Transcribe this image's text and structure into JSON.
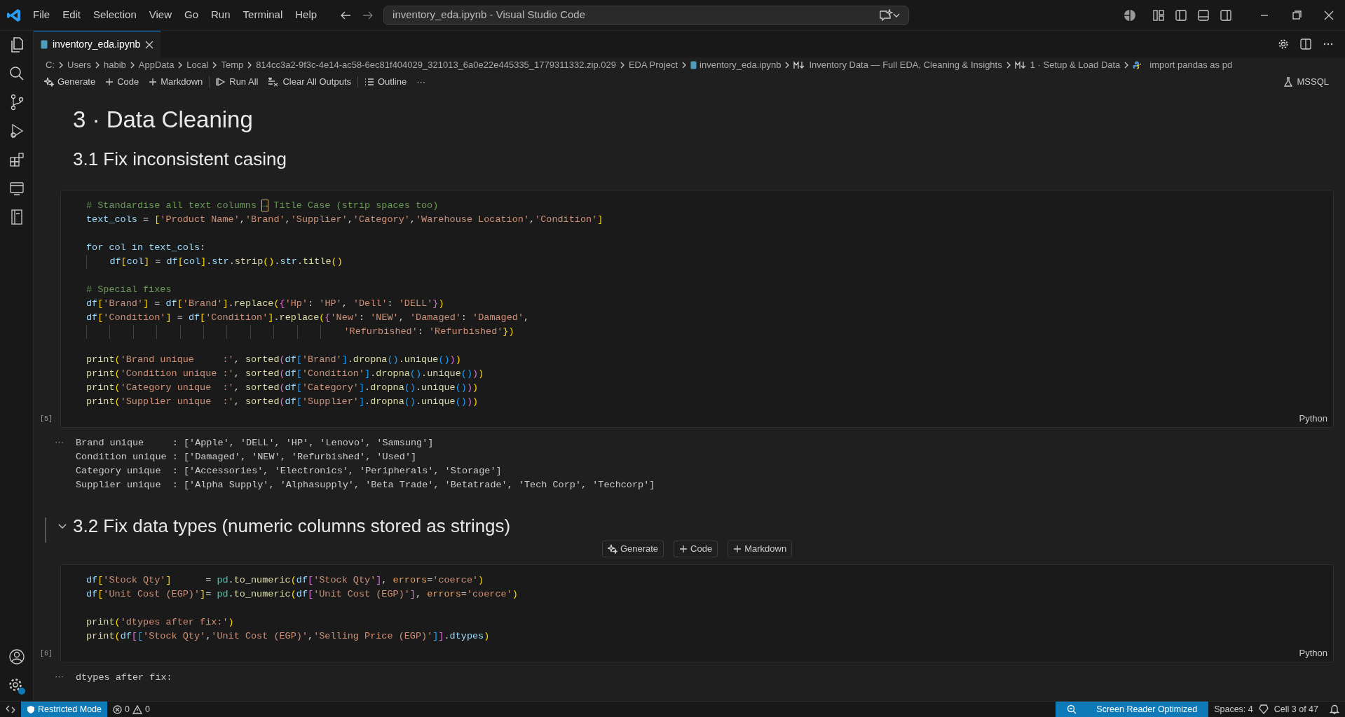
{
  "title_bar": {
    "menu": [
      "File",
      "Edit",
      "Selection",
      "View",
      "Go",
      "Run",
      "Terminal",
      "Help"
    ],
    "search": "inventory_eda.ipynb - Visual Studio Code"
  },
  "tabs": [
    {
      "label": "inventory_eda.ipynb",
      "selected": true
    }
  ],
  "breadcrumb": [
    {
      "kind": "text",
      "label": "C:"
    },
    {
      "kind": "text",
      "label": "Users"
    },
    {
      "kind": "text",
      "label": "habib"
    },
    {
      "kind": "text",
      "label": "AppData"
    },
    {
      "kind": "text",
      "label": "Local"
    },
    {
      "kind": "text",
      "label": "Temp"
    },
    {
      "kind": "text",
      "label": "814cc3a2-9f3c-4e14-ac58-6ec81f404029_321013_6a0e22e445335_1779311332.zip.029"
    },
    {
      "kind": "text",
      "label": "EDA Project"
    },
    {
      "kind": "notebook",
      "label": "inventory_eda.ipynb"
    },
    {
      "kind": "markdown",
      "label": "Inventory Data — Full EDA, Cleaning & Insights"
    },
    {
      "kind": "markdown",
      "label": "1 · Setup & Load Data"
    },
    {
      "kind": "python",
      "label": "import pandas as pd"
    }
  ],
  "toolbar": [
    {
      "kind": "sparkle",
      "label": "Generate"
    },
    {
      "kind": "plus",
      "label": "Code"
    },
    {
      "kind": "plus",
      "label": "Markdown"
    },
    {
      "kind": "run",
      "label": "Run All"
    },
    {
      "kind": "clear",
      "label": "Clear All Outputs"
    },
    {
      "kind": "outline",
      "label": "Outline"
    },
    {
      "kind": "more",
      "label": "···"
    }
  ],
  "kernel": "MSSQL",
  "cells": [
    {
      "kind": "heading1",
      "text": "3 · Data Cleaning"
    },
    {
      "kind": "heading2",
      "text": "3.1 Fix inconsistent casing"
    },
    {
      "kind": "code",
      "count": "[5]",
      "language": "Python",
      "lines": [
        {
          "text": "# Standardise all text columns → Title Case (strip spaces too)"
        },
        {
          "text": "text_cols = ['Product Name','Brand','Supplier','Category','Warehouse Location','Condition']"
        },
        {
          "text": "for col in text_cols:",
          "gap_before": true
        },
        {
          "text": "    df[col] = df[col].str.strip().str.title()"
        },
        {
          "text": "# Special fixes",
          "gap_before": true
        },
        {
          "text": "df['Brand'] = df['Brand'].replace({'Hp': 'HP', 'Dell': 'DELL'})"
        },
        {
          "text": "df['Condition'] = df['Condition'].replace({'New': 'NEW', 'Damaged': 'Damaged',"
        },
        {
          "text": "                                            'Refurbished': 'Refurbished'})"
        },
        {
          "text": "print('Brand unique     :', sorted(df['Brand'].dropna().unique()))",
          "gap_before": true
        },
        {
          "text": "print('Condition unique :', sorted(df['Condition'].dropna().unique()))"
        },
        {
          "text": "print('Category unique  :', sorted(df['Category'].dropna().unique()))"
        },
        {
          "text": "print('Supplier unique  :', sorted(df['Supplier'].dropna().unique()))"
        }
      ]
    },
    {
      "kind": "output",
      "menu": "···",
      "lines": [
        "Brand unique     : ['Apple', 'DELL', 'HP', 'Lenovo', 'Samsung']",
        "Condition unique : ['Damaged', 'NEW', 'Refurbished', 'Used']",
        "Category unique  : ['Accessories', 'Electronics', 'Peripherals', 'Storage']",
        "Supplier unique  : ['Alpha Supply', 'Alphasupply', 'Beta Trade', 'Betatrade', 'Tech Corp', 'Techcorp']"
      ]
    },
    {
      "kind": "heading2",
      "text": "3.2 Fix data types (numeric columns stored as strings)",
      "expanded": true
    },
    {
      "kind": "insert",
      "buttons": [
        {
          "kind": "sparkle",
          "label": "Generate"
        },
        {
          "kind": "plus",
          "label": "Code"
        },
        {
          "kind": "plus",
          "label": "Markdown"
        }
      ]
    },
    {
      "kind": "code",
      "count": "[6]",
      "language": "Python",
      "lines": [
        {
          "text": "df['Stock Qty']      = pd.to_numeric(df['Stock Qty'], errors='coerce')"
        },
        {
          "text": "df['Unit Cost (EGP)']= pd.to_numeric(df['Unit Cost (EGP)'], errors='coerce')"
        },
        {
          "text": "print('dtypes after fix:')",
          "gap_before": true
        },
        {
          "text": "print(df[['Stock Qty','Unit Cost (EGP)','Selling Price (EGP)']].dtypes)"
        }
      ]
    },
    {
      "kind": "output",
      "menu": "···",
      "lines": [
        "dtypes after fix:"
      ]
    }
  ],
  "status_bar": {
    "restricted": "Restricted Mode",
    "errors": "0",
    "warnings": "0",
    "screen_reader": "Screen Reader Optimized",
    "spaces": "Spaces: 4",
    "cell": "Cell 3 of 47"
  }
}
